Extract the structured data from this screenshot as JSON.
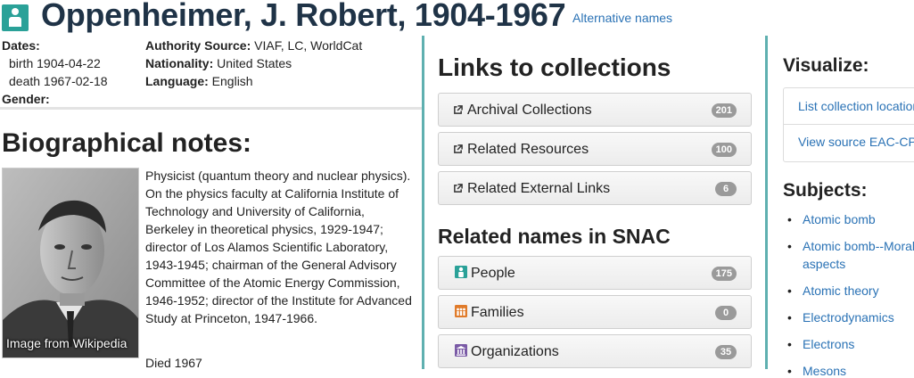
{
  "header": {
    "title": "Oppenheimer, J. Robert, 1904-1967",
    "alt_names_link": "Alternative names",
    "icon": "person-icon"
  },
  "facts": {
    "dates_label": "Dates:",
    "birth": "birth 1904-04-22",
    "death": "death 1967-02-18",
    "gender_label": "Gender:",
    "authority_label": "Authority Source:",
    "authority_value": "VIAF, LC, WorldCat",
    "nationality_label": "Nationality:",
    "nationality_value": "United States",
    "language_label": "Language:",
    "language_value": "English"
  },
  "bio": {
    "heading": "Biographical notes:",
    "photo_caption": "Image from Wikipedia",
    "text": "Physicist (quantum theory and nuclear physics). On the physics faculty at California Institute of Technology and University of California, Berkeley in theoretical physics, 1929-1947; director of Los Alamos Scientific Laboratory, 1943-1945; chairman of the General Advisory Committee of the Atomic Energy Commission, 1946-1952; director of the Institute for Advanced Study at Princeton, 1947-1966.",
    "died": "Died 1967"
  },
  "links": {
    "heading": "Links to collections",
    "buttons": [
      {
        "label": "Archival Collections",
        "count": "201",
        "icon": "external-link-icon"
      },
      {
        "label": "Related Resources",
        "count": "100",
        "icon": "external-link-icon"
      },
      {
        "label": "Related External Links",
        "count": "6",
        "icon": "external-link-icon"
      }
    ]
  },
  "related": {
    "heading": "Related names in SNAC",
    "buttons": [
      {
        "label": "People",
        "count": "175",
        "icon": "person-icon",
        "color": "#2aa198"
      },
      {
        "label": "Families",
        "count": "0",
        "icon": "family-icon",
        "color": "#e07b2a"
      },
      {
        "label": "Organizations",
        "count": "35",
        "icon": "organization-icon",
        "color": "#7a5aa6"
      }
    ]
  },
  "visualize": {
    "heading": "Visualize:",
    "items": [
      "List collection locations",
      "View source EAC-CPF"
    ]
  },
  "subjects": {
    "heading": "Subjects:",
    "items": [
      {
        "line1": "Atomic bomb",
        "line2": ""
      },
      {
        "line1": "Atomic bomb--Moral",
        "line2": "aspects"
      },
      {
        "line1": "Atomic theory",
        "line2": ""
      },
      {
        "line1": "Electrodynamics",
        "line2": ""
      },
      {
        "line1": "Electrons",
        "line2": ""
      },
      {
        "line1": "Mesons",
        "line2": ""
      }
    ]
  },
  "colors": {
    "title": "#1f3347",
    "link": "#2a72b5",
    "divider": "#5fb0b0",
    "badge": "#9a9a9a"
  }
}
